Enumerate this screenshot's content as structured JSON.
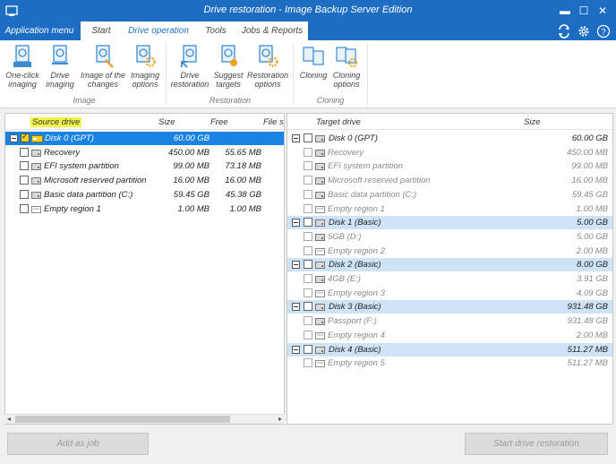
{
  "window": {
    "title": "Drive restoration - Image Backup Server Edition",
    "minimize": "▬",
    "maximize": "☐",
    "close": "✕"
  },
  "ribbon_tabs": {
    "app_menu": "Application menu",
    "tabs": [
      "Start",
      "Drive operation",
      "Tools",
      "Jobs & Reports"
    ],
    "active_tab": "Drive operation"
  },
  "quick_access": [
    "sync-icon",
    "gear-icon",
    "help-icon"
  ],
  "ribbon": {
    "groups": [
      {
        "label": "Image",
        "buttons": [
          {
            "l1": "One-click",
            "l2": "imaging",
            "icon": "one-click-imaging-icon"
          },
          {
            "l1": "Drive",
            "l2": "imaging",
            "icon": "drive-imaging-icon"
          },
          {
            "l1": "Image of the",
            "l2": "changes",
            "icon": "image-changes-icon"
          },
          {
            "l1": "Imaging",
            "l2": "options",
            "icon": "imaging-options-icon"
          }
        ]
      },
      {
        "label": "Restoration",
        "buttons": [
          {
            "l1": "Drive",
            "l2": "restoration",
            "icon": "drive-restoration-icon"
          },
          {
            "l1": "Suggest",
            "l2": "targets",
            "icon": "suggest-targets-icon"
          },
          {
            "l1": "Restoration",
            "l2": "options",
            "icon": "restoration-options-icon"
          }
        ]
      },
      {
        "label": "Cloning",
        "buttons": [
          {
            "l1": "Cloning",
            "l2": "",
            "icon": "cloning-icon"
          },
          {
            "l1": "Cloning",
            "l2": "options",
            "icon": "cloning-options-icon"
          }
        ]
      }
    ]
  },
  "source": {
    "headers": {
      "name": "Source drive",
      "size": "Size",
      "free": "Free",
      "fs": "File sy"
    },
    "rows": [
      {
        "name": "Disk 0 (GPT)",
        "size": "60.00 GB",
        "free": "",
        "type": "disk",
        "checked": true
      },
      {
        "name": "Recovery",
        "size": "450.00 MB",
        "free": "55.65 MB",
        "type": "part"
      },
      {
        "name": "EFI system partition",
        "size": "99.00 MB",
        "free": "73.18 MB",
        "type": "part"
      },
      {
        "name": "Microsoft reserved partition",
        "size": "16.00 MB",
        "free": "16.00 MB",
        "type": "part"
      },
      {
        "name": "Basic data partition (C:)",
        "size": "59.45 GB",
        "free": "45.38 GB",
        "type": "part"
      },
      {
        "name": "Empty region 1",
        "size": "1.00 MB",
        "free": "1.00 MB",
        "type": "empty"
      }
    ]
  },
  "target": {
    "headers": {
      "name": "Target drive",
      "size": "Size"
    },
    "rows": [
      {
        "name": "Disk 0 (GPT)",
        "size": "60.00 GB",
        "type": "disk-gray"
      },
      {
        "name": "Recovery",
        "size": "450.00 MB",
        "type": "part"
      },
      {
        "name": "EFI system partition",
        "size": "99.00 MB",
        "type": "part"
      },
      {
        "name": "Microsoft reserved partition",
        "size": "16.00 MB",
        "type": "part"
      },
      {
        "name": "Basic data partition (C:)",
        "size": "59.45 GB",
        "type": "part"
      },
      {
        "name": "Empty region 1",
        "size": "1.00 MB",
        "type": "empty"
      },
      {
        "name": "Disk 1 (Basic)",
        "size": "5.00 GB",
        "type": "disk"
      },
      {
        "name": "5GB (D:)",
        "size": "5.00 GB",
        "type": "part"
      },
      {
        "name": "Empty region 2",
        "size": "2.00 MB",
        "type": "empty"
      },
      {
        "name": "Disk 2 (Basic)",
        "size": "8.00 GB",
        "type": "disk"
      },
      {
        "name": "4GB (E:)",
        "size": "3.91 GB",
        "type": "part"
      },
      {
        "name": "Empty region 3",
        "size": "4.09 GB",
        "type": "empty"
      },
      {
        "name": "Disk 3 (Basic)",
        "size": "931.48 GB",
        "type": "disk"
      },
      {
        "name": "Passport (F:)",
        "size": "931.48 GB",
        "type": "part"
      },
      {
        "name": "Empty region 4",
        "size": "2.00 MB",
        "type": "empty"
      },
      {
        "name": "Disk 4 (Basic)",
        "size": "511.27 MB",
        "type": "disk"
      },
      {
        "name": "Empty region 5",
        "size": "511.27 MB",
        "type": "empty"
      }
    ]
  },
  "buttons": {
    "add_as_job": "Add as job",
    "start_restoration": "Start drive restoration"
  },
  "colors": {
    "accent": "#1d6ec3",
    "selection": "#1a82e2",
    "disk_row": "#cfe3f7",
    "highlight": "#f4f44a"
  }
}
